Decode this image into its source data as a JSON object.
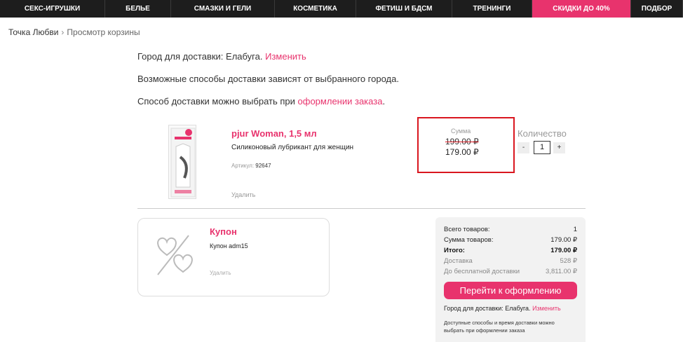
{
  "nav": [
    {
      "label": "СЕКС-ИГРУШКИ",
      "w": 150
    },
    {
      "label": "БЕЛЬЕ",
      "w": 94
    },
    {
      "label": "СМАЗКИ И ГЕЛИ",
      "w": 148
    },
    {
      "label": "КОСМЕТИКА",
      "w": 116
    },
    {
      "label": "ФЕТИШ И БДСМ",
      "w": 137
    },
    {
      "label": "ТРЕНИНГИ",
      "w": 114
    },
    {
      "label": "СКИДКИ ДО 40%",
      "w": 141,
      "sale": true
    },
    {
      "label": "ПОДБОР",
      "w": 74
    }
  ],
  "breadcrumb": {
    "home": "Точка Любви",
    "separator": "›",
    "current": "Просмотр корзины"
  },
  "delivery_info": {
    "city_prefix": "Город для доставки: Елабуга.",
    "city_change": "Изменить",
    "methods_note": "Возможные способы доставки зависят от выбранного города.",
    "method_prefix": "Способ доставки можно выбрать при",
    "method_link": "оформлении заказа",
    "method_suffix": "."
  },
  "product": {
    "title": "pjur Woman, 1,5 мл",
    "description": "Силиконовый лубрикант для женщин",
    "article_label": "Артикул:",
    "article_value": "92647",
    "delete_label": "Удалить",
    "sum_label": "Сумма",
    "old_price": "199.00 ₽",
    "new_price": "179.00 ₽",
    "quantity_label": "Количество",
    "quantity": "1",
    "minus": "-",
    "plus": "+"
  },
  "coupon": {
    "title": "Купон",
    "code": "Купон adm15",
    "delete_label": "Удалить"
  },
  "summary": {
    "rows": [
      {
        "label": "Всего товаров:",
        "value": "1",
        "style": ""
      },
      {
        "label": "Сумма товаров:",
        "value": "179.00 ₽",
        "style": ""
      },
      {
        "label": "Итого:",
        "value": "179.00 ₽",
        "style": "bold"
      },
      {
        "label": "Доставка",
        "value": "528 ₽",
        "style": "muted"
      },
      {
        "label": "До бесплатной доставки",
        "value": "3,811.00 ₽",
        "style": "muted"
      }
    ],
    "checkout_label": "Перейти к оформлению",
    "city_prefix": "Город для доставки: Елабуга.",
    "city_change": "Изменить",
    "note": "Доступные способы и время доставки можно выбрать при оформлении заказа"
  },
  "colors": {
    "accent": "#e8336d",
    "nav_bg": "#1d1d1d",
    "highlight_border": "#d9161f"
  }
}
